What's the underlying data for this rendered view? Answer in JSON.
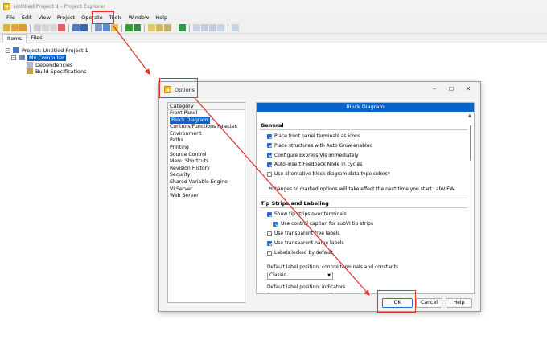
{
  "window": {
    "title": "Untitled Project 1 - Project Explorer"
  },
  "menu": [
    "File",
    "Edit",
    "View",
    "Project",
    "Operate",
    "Tools",
    "Window",
    "Help"
  ],
  "tabs": [
    "Items",
    "Files"
  ],
  "tree": {
    "project": "Project: Untitled Project 1",
    "computer": "My Computer",
    "dependencies": "Dependencies",
    "build": "Build Specifications"
  },
  "dialog": {
    "title": "Options",
    "category_header": "Category",
    "categories": [
      "Front Panel",
      "Block Diagram",
      "Controls/Functions Palettes",
      "Environment",
      "Paths",
      "Printing",
      "Source Control",
      "Menu Shortcuts",
      "Revision History",
      "Security",
      "Shared Variable Engine",
      "VI Server",
      "Web Server"
    ],
    "selected_category": "Block Diagram",
    "panel_header": "Block Diagram",
    "general": {
      "title": "General",
      "options": [
        {
          "label": "Place front panel terminals as icons",
          "checked": true
        },
        {
          "label": "Place structures with Auto Grow enabled",
          "checked": true
        },
        {
          "label": "Configure Express VIs immediately",
          "checked": true
        },
        {
          "label": "Auto-insert Feedback Node in cycles",
          "checked": true
        },
        {
          "label": "Use alternative block diagram data type colors*",
          "checked": false
        }
      ],
      "note": "*Changes to marked options will take effect the next time you start LabVIEW."
    },
    "tips": {
      "title": "Tip Strips and Labeling",
      "options": [
        {
          "label": "Show tip strips over terminals",
          "checked": true
        },
        {
          "label": "Use control caption for subVI tip strips",
          "checked": true
        },
        {
          "label": "Use transparent free labels",
          "checked": false
        },
        {
          "label": "Use transparent name labels",
          "checked": true
        },
        {
          "label": "Labels locked by default",
          "checked": false
        }
      ],
      "label_pos_controls": "Default label position: control terminals and constants",
      "label_pos_controls_value": "Classic",
      "label_pos_indicators": "Default label position: indicators"
    },
    "buttons": {
      "ok": "OK",
      "cancel": "Cancel",
      "help": "Help"
    }
  }
}
